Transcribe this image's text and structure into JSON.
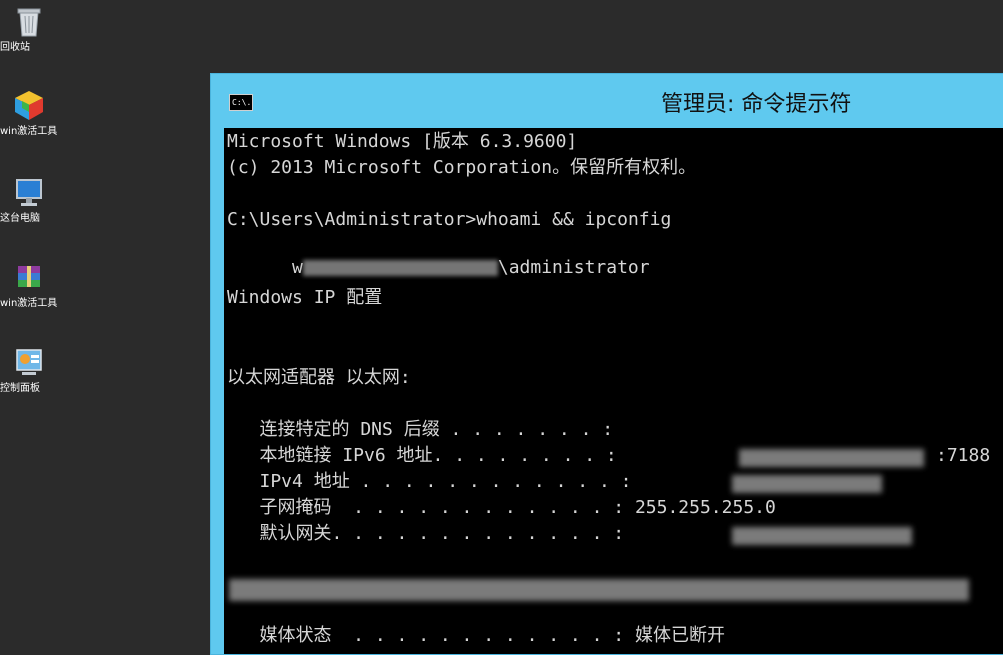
{
  "desktop": {
    "icons": [
      {
        "label": "回收站"
      },
      {
        "label": "win激活工具"
      },
      {
        "label": "这台电脑"
      },
      {
        "label": "win激活工具"
      },
      {
        "label": "控制面板"
      }
    ]
  },
  "window": {
    "title": "管理员: 命令提示符",
    "icon_text": "C:\\."
  },
  "console": {
    "lines": [
      "Microsoft Windows [版本 6.3.9600]",
      "(c) 2013 Microsoft Corporation。保留所有权利。",
      "",
      "C:\\Users\\Administrator>whoami && ipconfig",
      "\\administrator",
      "",
      "Windows IP 配置",
      "",
      "",
      "以太网适配器 以太网:",
      "",
      "   连接特定的 DNS 后缀 . . . . . . . :",
      "   本地链接 IPv6 地址. . . . . . . . :",
      "   IPv4 地址 . . . . . . . . . . . . :",
      "   子网掩码  . . . . . . . . . . . . : 255.255.255.0",
      "   默认网关. . . . . . . . . . . . . :",
      "",
      "   媒体状态  . . . . . . . . . . . . : 媒体已断开"
    ],
    "ipv6_suffix": ":7188",
    "line0_prefix": "w"
  },
  "colors": {
    "titlebar": "#5fc9ef",
    "console_bg": "#000000",
    "console_fg": "#d6d6d6",
    "desktop_bg": "#2b2b2b"
  }
}
